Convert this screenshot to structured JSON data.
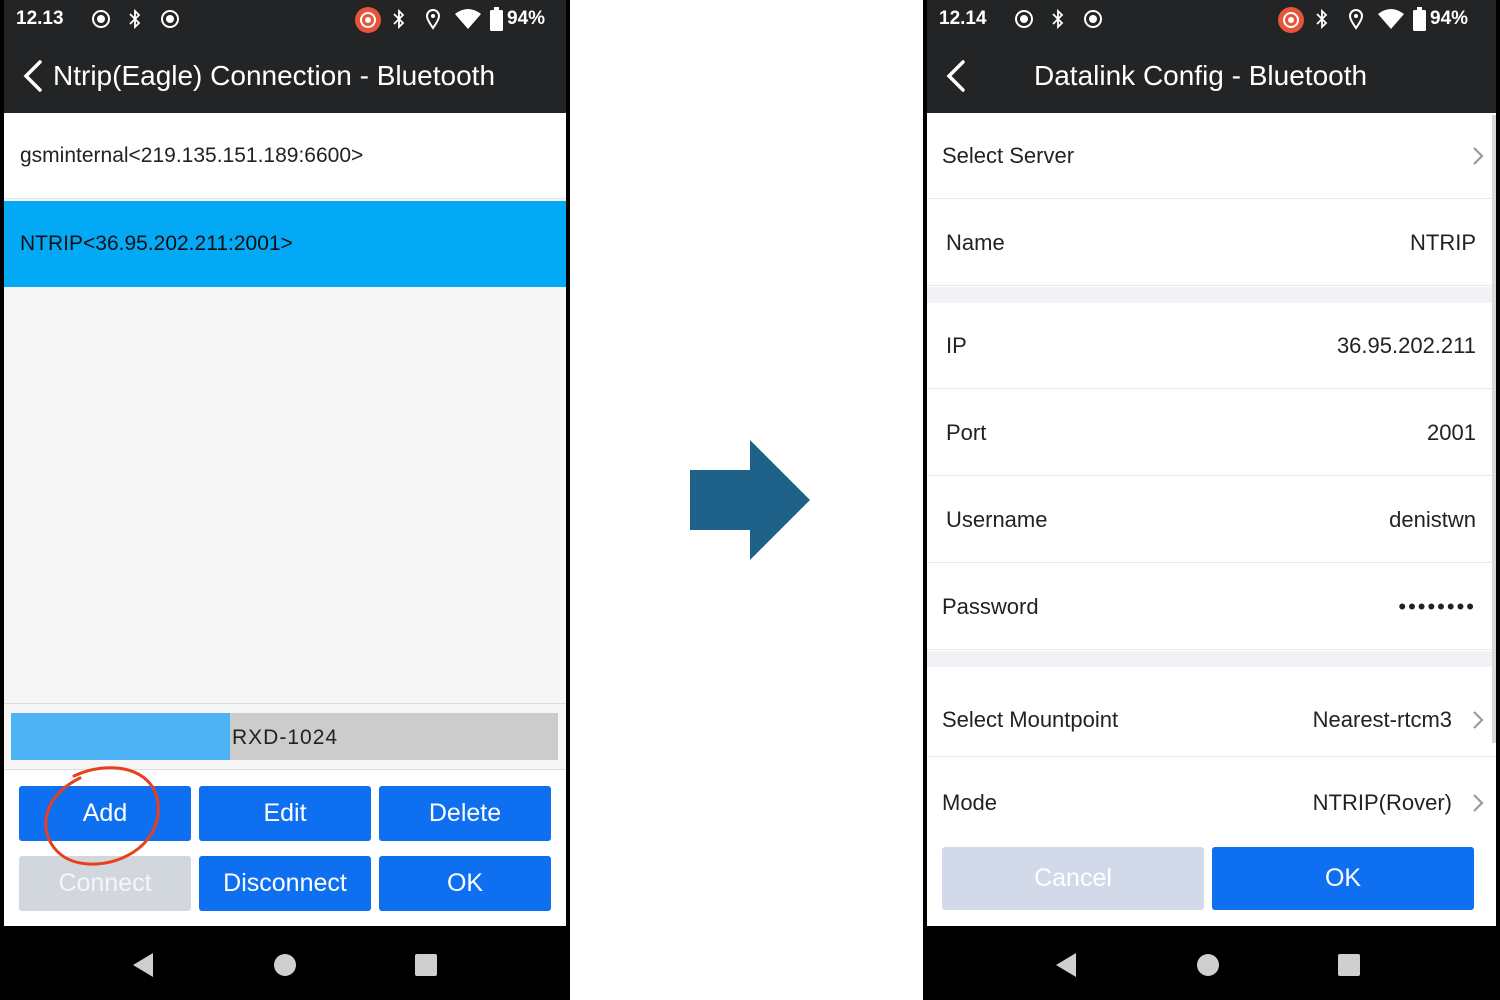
{
  "left_screen": {
    "status": {
      "time": "12.13",
      "battery": "94%"
    },
    "title": "Ntrip(Eagle) Connection - Bluetooth",
    "connections": [
      {
        "label": "gsminternal<219.135.151.189:6600>",
        "selected": false
      },
      {
        "label": "NTRIP<36.95.202.211:2001>",
        "selected": true
      }
    ],
    "progress": {
      "label": "RXD-1024",
      "fraction": 0.4
    },
    "buttons": {
      "add": "Add",
      "edit": "Edit",
      "delete": "Delete",
      "connect": "Connect",
      "disconnect": "Disconnect",
      "ok": "OK"
    }
  },
  "right_screen": {
    "status": {
      "time": "12.14",
      "battery": "94%"
    },
    "title": "Datalink Config - Bluetooth",
    "select_server": {
      "label": "Select Server"
    },
    "name": {
      "label": "Name",
      "value": "NTRIP"
    },
    "ip": {
      "label": "IP",
      "value": "36.95.202.211"
    },
    "port": {
      "label": "Port",
      "value": "2001"
    },
    "username": {
      "label": "Username",
      "value": "denistwn"
    },
    "password": {
      "label": "Password",
      "value": "••••••••"
    },
    "mountpoint": {
      "label": "Select Mountpoint",
      "value": "Nearest-rtcm3"
    },
    "mode": {
      "label": "Mode",
      "value": "NTRIP(Rover)"
    },
    "buttons": {
      "cancel": "Cancel",
      "ok": "OK"
    }
  },
  "colors": {
    "appbar": "#222426",
    "selected_row": "#03a9f4",
    "primary_button": "#0e6ff0",
    "disabled_button": "#d2d7de",
    "progress_fill": "#4db3f5",
    "arrow": "#1f6289",
    "annotation_circle": "#e8401c"
  },
  "icons": [
    "back-icon",
    "bluetooth-icon",
    "location-icon",
    "wifi-icon",
    "battery-icon",
    "record-icon",
    "chevron-right-icon",
    "nav-back-icon",
    "nav-home-icon",
    "nav-recents-icon",
    "arrow-right-icon"
  ]
}
